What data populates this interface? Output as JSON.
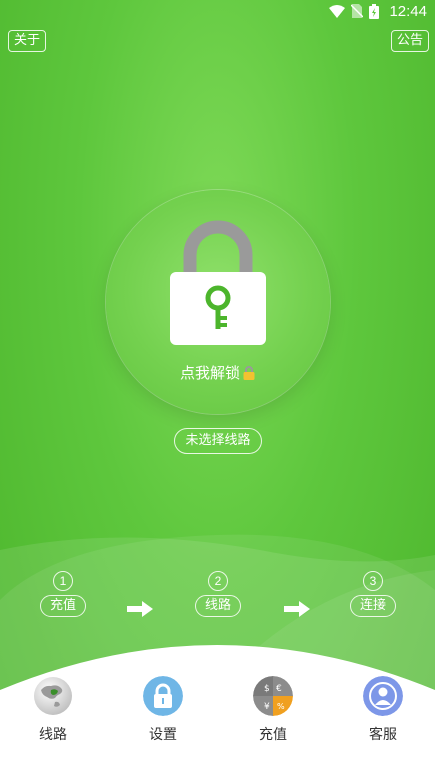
{
  "status_bar": {
    "time": "12:44"
  },
  "header": {
    "about_label": "关于",
    "notice_label": "公告"
  },
  "lock": {
    "unlock_label": "点我解锁",
    "route_status": "未选择线路"
  },
  "steps": [
    {
      "number": "1",
      "label": "充值"
    },
    {
      "number": "2",
      "label": "线路"
    },
    {
      "number": "3",
      "label": "连接"
    }
  ],
  "nav": [
    {
      "label": "线路",
      "icon": "globe-icon"
    },
    {
      "label": "设置",
      "icon": "lock-icon"
    },
    {
      "label": "充值",
      "icon": "calculator-icon"
    },
    {
      "label": "客服",
      "icon": "user-icon"
    }
  ],
  "colors": {
    "primary_green": "#5ec73d",
    "key_green": "#4cb52c",
    "nav_white": "#ffffff"
  }
}
